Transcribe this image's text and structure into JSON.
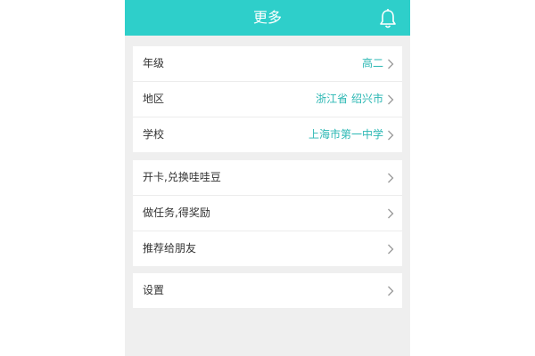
{
  "header": {
    "title": "更多",
    "icon": "bell-icon"
  },
  "colors": {
    "header_bg": "#2ecfca",
    "accent_text": "#2ab7b3",
    "page_bg": "#efefef"
  },
  "profile": {
    "grade": {
      "label": "年级",
      "value": "高二"
    },
    "region": {
      "label": "地区",
      "value": "浙江省 绍兴市"
    },
    "school": {
      "label": "学校",
      "value": "上海市第一中学"
    }
  },
  "actions": {
    "open_card": {
      "label": "开卡,兑换哇哇豆"
    },
    "tasks": {
      "label": "做任务,得奖励"
    },
    "recommend": {
      "label": "推荐给朋友"
    }
  },
  "misc": {
    "settings": {
      "label": "设置"
    }
  }
}
